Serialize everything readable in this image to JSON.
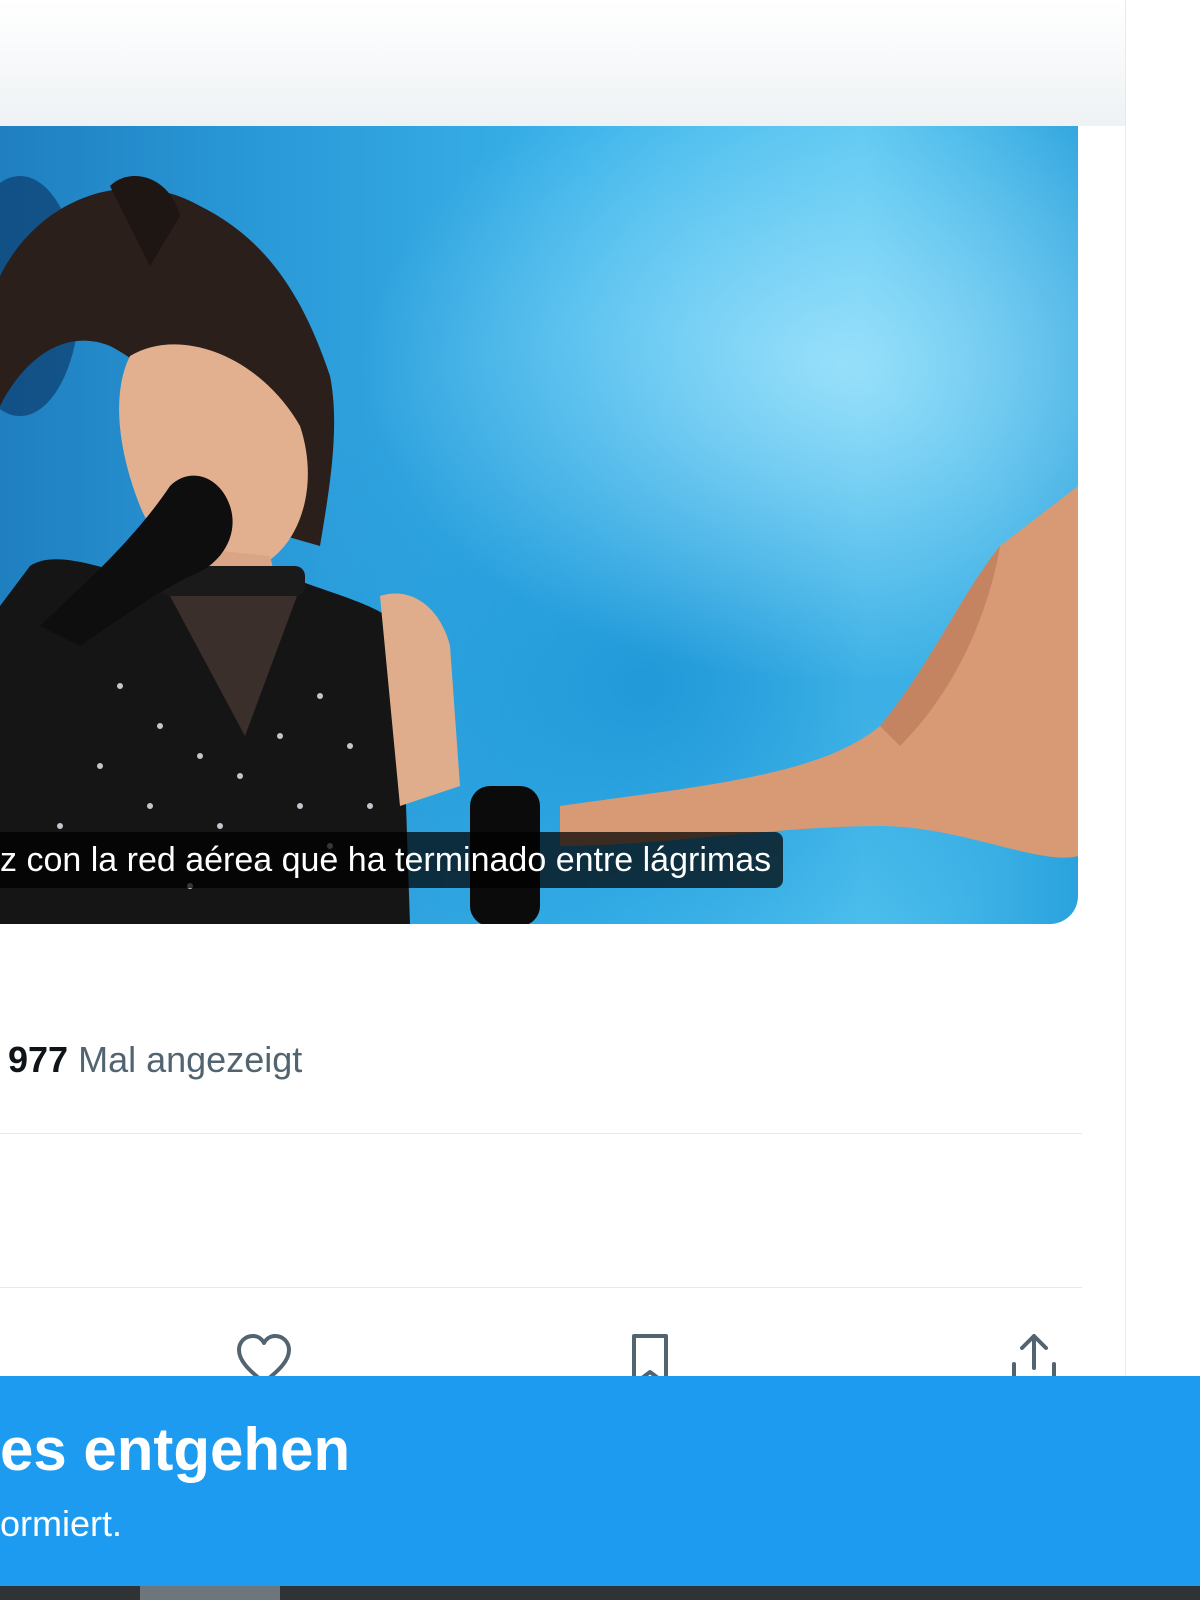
{
  "media": {
    "caption": "z con la red aérea que ha terminado entre lágrimas"
  },
  "stats": {
    "views_count": "977",
    "views_label": "Mal angezeigt"
  },
  "actions": {
    "like_icon": "heart-icon",
    "bookmark_icon": "bookmark-icon",
    "share_icon": "share-icon"
  },
  "banner": {
    "title": "es entgehen",
    "subtitle": "ormiert.",
    "background": "#1d9bf0"
  },
  "colors": {
    "text_primary": "#0f1419",
    "text_secondary": "#536471",
    "divider": "#e7eaec"
  }
}
